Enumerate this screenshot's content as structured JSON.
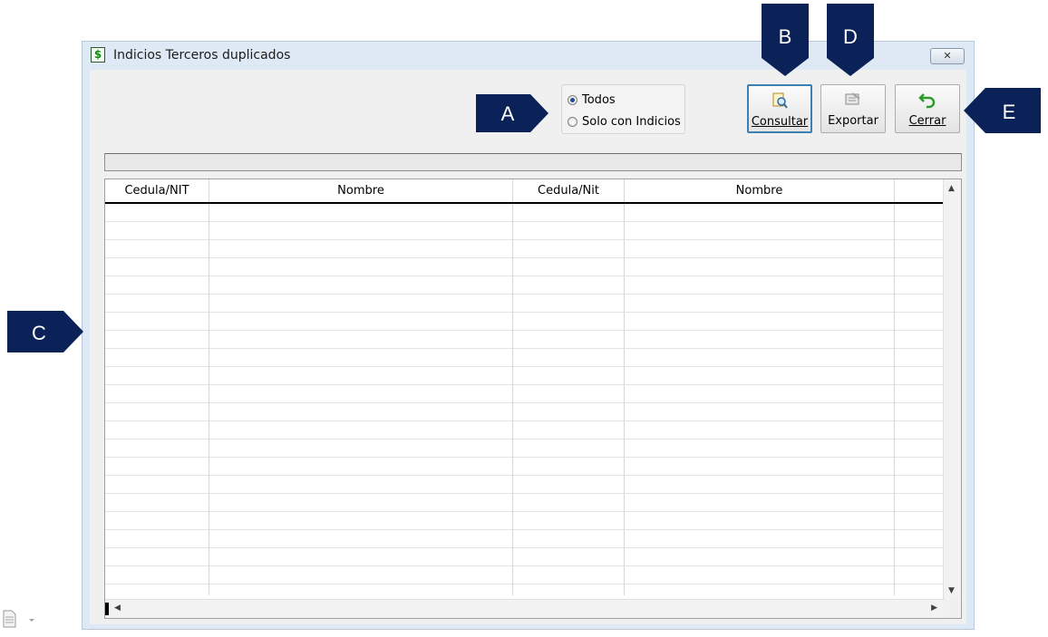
{
  "window": {
    "title": "Indicios Terceros duplicados",
    "icon": "dollar-sheet-icon",
    "close_symbol": "✕"
  },
  "filter": {
    "options": [
      {
        "label": "Todos",
        "selected": true
      },
      {
        "label": "Solo con Indicios",
        "selected": false
      }
    ]
  },
  "toolbar": {
    "consultar_label": "Consultar",
    "consultar_icon": "search-document-icon",
    "exportar_label": "Exportar",
    "exportar_icon": "export-icon",
    "cerrar_label": "Cerrar",
    "cerrar_icon": "undo-arrow-icon"
  },
  "progress": {
    "value": 0
  },
  "grid": {
    "columns": [
      "Cedula/NIT",
      "Nombre",
      "Cedula/Nit",
      "Nombre",
      ""
    ],
    "rows": []
  },
  "callouts": {
    "a": "A",
    "b": "B",
    "c": "C",
    "d": "D",
    "e": "E"
  },
  "colors": {
    "callout_bg": "#0a2257",
    "window_bg": "#dfe9f5",
    "focus_border": "#3c7fb1"
  }
}
